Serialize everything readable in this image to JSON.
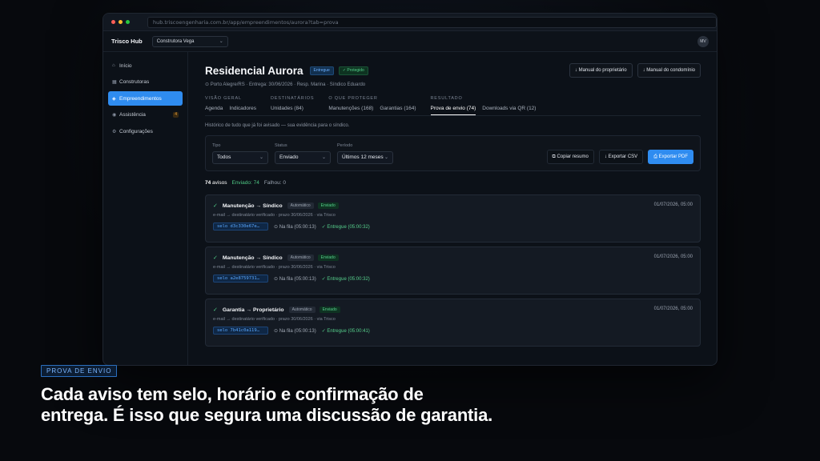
{
  "browser": {
    "url": "hub.triscoengenharia.com.br/app/empreendimentos/aurora?tab=prova"
  },
  "appbar": {
    "brand": "Trisco Hub",
    "org_select": "Construtora Vega",
    "avatar": "MV"
  },
  "sidebar": {
    "items": [
      {
        "label": "Início",
        "icon": "home-icon"
      },
      {
        "label": "Construtoras",
        "icon": "building-icon"
      },
      {
        "label": "Empreendimentos",
        "icon": "diamond-icon",
        "active": true
      },
      {
        "label": "Assistência",
        "icon": "support-icon",
        "count": "4"
      },
      {
        "label": "Configurações",
        "icon": "gear-icon"
      }
    ]
  },
  "header": {
    "title": "Residencial Aurora",
    "badge_status": "Entregue",
    "badge_protected": "✓ Protegido",
    "subtitle": "⊙ Porto Alegre/RS · Entrega: 30/06/2026 · Resp. Marina · Síndico Eduardo",
    "btn_owner_manual": "↓ Manual do proprietário",
    "btn_condo_manual": "↓ Manual do condomínio"
  },
  "tabgroups": [
    {
      "label": "VISÃO GERAL",
      "tabs": [
        "Agenda",
        "Indicadores"
      ]
    },
    {
      "label": "DESTINATÁRIOS",
      "tabs": [
        "Unidades (84)"
      ]
    },
    {
      "label": "O QUE PROTEGER",
      "tabs": [
        "Manutenções (168)",
        "Garantias (164)"
      ]
    },
    {
      "label": "RESULTADO",
      "tabs": [
        "Prova de envio (74)",
        "Downloads via QR (12)"
      ]
    }
  ],
  "intro": "Histórico de tudo que já foi avisado — sua evidência para o síndico.",
  "filters": {
    "tipo": {
      "label": "Tipo",
      "value": "Todos"
    },
    "status": {
      "label": "Status",
      "value": "Enviado"
    },
    "periodo": {
      "label": "Período",
      "value": "Últimos 12 meses"
    },
    "btn_copy": "⧉ Copiar resumo",
    "btn_csv": "↓ Exportar CSV",
    "btn_pdf": "⎙ Exportar PDF"
  },
  "stats": {
    "total_num": "74",
    "total_label": "avisos",
    "sent": "Enviado: 74",
    "failed": "Falhou: 0"
  },
  "notices": [
    {
      "title": "Manutenção → Síndico",
      "tag_auto": "Automático",
      "tag_sent": "Enviado",
      "date": "01/07/2026, 05:00",
      "meta": "e-mail → destinatário verificado · prazo 30/06/2026 · via Trisco",
      "seal": "selo d3c330e67e…",
      "queue": "⊙ Na fila (05:00:13)",
      "delivered": "✓ Entregue (05:00:32)"
    },
    {
      "title": "Manutenção → Síndico",
      "tag_auto": "Automático",
      "tag_sent": "Enviado",
      "date": "01/07/2026, 05:00",
      "meta": "e-mail → destinatário verificado · prazo 30/06/2026 · via Trisco",
      "seal": "selo a2e8759731…",
      "queue": "⊙ Na fila (05:00:13)",
      "delivered": "✓ Entregue (05:00:32)"
    },
    {
      "title": "Garantia → Proprietário",
      "tag_auto": "Automático",
      "tag_sent": "Enviado",
      "date": "01/07/2026, 05:00",
      "meta": "e-mail → destinatário verificado · prazo 30/06/2026 · via Trisco",
      "seal": "selo 7b41c0a119…",
      "queue": "⊙ Na fila (05:00:13)",
      "delivered": "✓ Entregue (05:00:41)"
    }
  ],
  "caption": {
    "badge": "PROVA DE ENVIO",
    "line1": "Cada aviso tem selo, horário e confirmação de",
    "line2": "entrega. É isso que segura uma discussão de garantia."
  }
}
